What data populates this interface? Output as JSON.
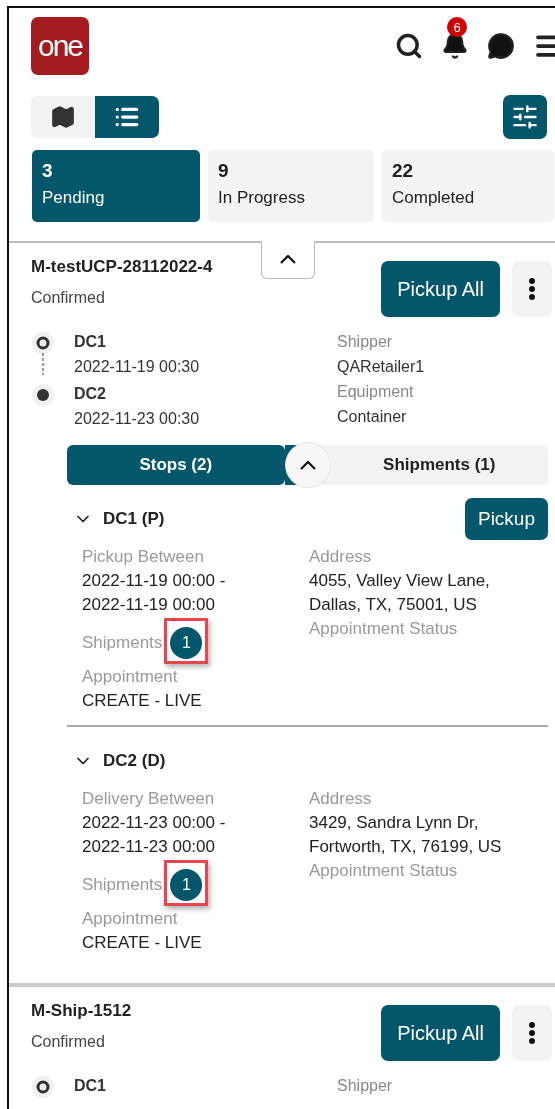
{
  "header": {
    "logo": "one",
    "notification_count": "6"
  },
  "view_toggle": [
    {
      "kind": "map",
      "selected": false
    },
    {
      "kind": "list",
      "selected": true
    }
  ],
  "status_tabs": [
    {
      "count": "3",
      "label": "Pending",
      "selected": true
    },
    {
      "count": "9",
      "label": "In Progress",
      "selected": false
    },
    {
      "count": "22",
      "label": "Completed",
      "selected": false
    }
  ],
  "filters_expanded": true,
  "orders": [
    {
      "id": "M-testUCP-28112022-4",
      "status": "Confirmed",
      "action": "Pickup All",
      "expanded": true,
      "route": [
        {
          "name": "DC1",
          "time": "2022-11-19 00:30"
        },
        {
          "name": "DC2",
          "time": "2022-11-23 00:30"
        }
      ],
      "details": [
        {
          "label": "Shipper",
          "value": "QARetailer1"
        },
        {
          "label": "Equipment",
          "value": "Container"
        }
      ],
      "tabs": [
        {
          "label": "Stops (2)",
          "selected": true
        },
        {
          "label": "Shipments (1)",
          "selected": false
        }
      ],
      "stops": [
        {
          "title": "DC1 (P)",
          "action": "Pickup",
          "expanded": true,
          "window_label": "Pickup Between",
          "window_value": "2022-11-19 00:00 -\n2022-11-19 00:00",
          "address_label": "Address",
          "address_value": "4055, Valley View Lane,\nDallas, TX, 75001, US",
          "shipments_label": "Shipments",
          "shipments_count": "1",
          "highlighted": true,
          "appointment_status_label": "Appointment Status",
          "appointment_label": "Appointment",
          "appointment_value": "CREATE - LIVE"
        },
        {
          "title": "DC2 (D)",
          "expanded": true,
          "window_label": "Delivery Between",
          "window_value": "2022-11-23 00:00 -\n2022-11-23 00:00",
          "address_label": "Address",
          "address_value": "3429, Sandra Lynn Dr,\nFortworth, TX, 76199, US",
          "shipments_label": "Shipments",
          "shipments_count": "1",
          "highlighted": true,
          "appointment_status_label": "Appointment Status",
          "appointment_label": "Appointment",
          "appointment_value": "CREATE - LIVE"
        }
      ]
    },
    {
      "id": "M-Ship-1512",
      "status": "Confirmed",
      "action": "Pickup All",
      "route": [
        {
          "name": "DC1"
        }
      ],
      "details": [
        {
          "label": "Shipper"
        }
      ]
    }
  ]
}
